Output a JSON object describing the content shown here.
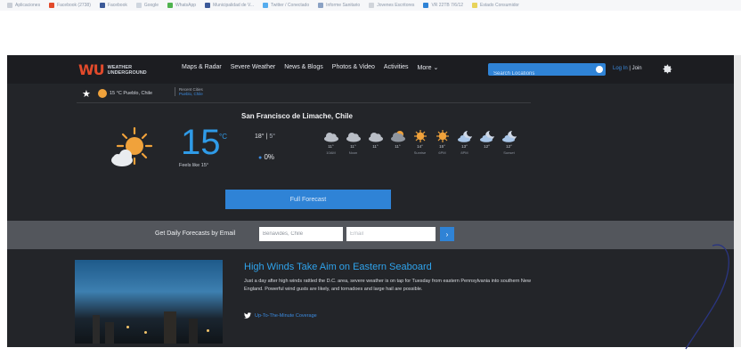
{
  "bookmarks": [
    {
      "label": "Aplicaciones",
      "color": "#c9ced6"
    },
    {
      "label": "Facebook (2738)",
      "color": "#e24a2b"
    },
    {
      "label": "Facebook",
      "color": "#3b5998"
    },
    {
      "label": "Google",
      "color": "#cfd6df"
    },
    {
      "label": "WhatsApp",
      "color": "#4fb34f"
    },
    {
      "label": "Municipalidad de V...",
      "color": "#3b5998"
    },
    {
      "label": "Twitter / Conectado",
      "color": "#55acee"
    },
    {
      "label": "Informe Sanitario",
      "color": "#8ba2c4"
    },
    {
      "label": "Jovenes Escritores",
      "color": "#d0d4da"
    },
    {
      "label": "VR 22TB 7/6/12",
      "color": "#2f83d6"
    },
    {
      "label": "Estado Consumidor",
      "color": "#e8d35a"
    }
  ],
  "nav": {
    "logo_mark": "WU",
    "logo_line1": "WEATHER",
    "logo_line2": "UNDERGROUND",
    "menu": [
      "Maps & Radar",
      "Severe Weather",
      "News & Blogs",
      "Photos & Video",
      "Activities",
      "More ⌄"
    ],
    "search_placeholder": "Search Locations",
    "login": "Log In",
    "join": "Join"
  },
  "subbar": {
    "favorite": "15 °C Pueblo, Chile",
    "recent_label": "Recent Cities",
    "recent_city": "Pueblo, Chile"
  },
  "current": {
    "city": "San Francisco de Limache, Chile",
    "temperature": "15",
    "unit": "°C",
    "feels_like": "Feels like 15°",
    "high": "18°",
    "low": "5°",
    "precip": "0%",
    "condition_icon": "partly-cloudy-sun-icon"
  },
  "hourly": [
    {
      "icon": "cloudy-icon",
      "temp": "11°",
      "label": "10AM"
    },
    {
      "icon": "cloudy-icon",
      "temp": "11°",
      "label": "Noon"
    },
    {
      "icon": "cloudy-icon",
      "temp": "11°",
      "label": ""
    },
    {
      "icon": "partly-cloudy-icon",
      "temp": "11°",
      "label": ""
    },
    {
      "icon": "sun-icon",
      "temp": "14°",
      "label": "Sunrise"
    },
    {
      "icon": "sun-icon",
      "temp": "15°",
      "label": "6PM"
    },
    {
      "icon": "moon-cloud-icon",
      "temp": "13°",
      "label": "8PM"
    },
    {
      "icon": "moon-cloud-icon",
      "temp": "12°",
      "label": ""
    },
    {
      "icon": "moon-cloud-icon",
      "temp": "12°",
      "label": "Sunset"
    }
  ],
  "forecast_button": "Full Forecast",
  "email": {
    "label": "Get Daily Forecasts by Email",
    "location_value": "Benavides, Chile",
    "email_placeholder": "Email",
    "go": "›"
  },
  "news": {
    "title": "High Winds Take Aim on Eastern Seaboard",
    "body": "Just a day after high winds rattled the D.C. area, severe weather is on tap for Tuesday from eastern Pennsylvania into southern New England. Powerful wind gusts are likely, and tornadoes and large hail are possible.",
    "link": "Up-To-The-Minute Coverage"
  },
  "colors": {
    "accent_blue": "#2f83d6",
    "temp_blue": "#2f9be8",
    "sun_orange": "#f0a23b",
    "background": "#232529"
  }
}
